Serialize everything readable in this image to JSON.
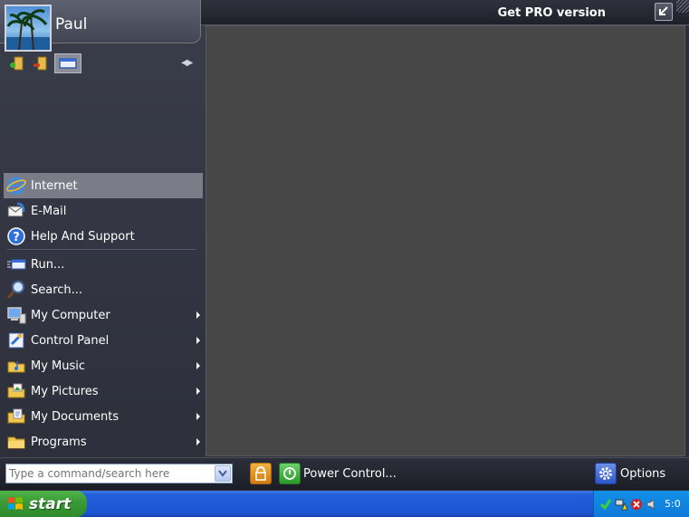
{
  "user": {
    "name": "Paul"
  },
  "header": {
    "get_pro": "Get PRO version"
  },
  "menu": {
    "pinned": [
      {
        "label": "Internet",
        "icon": "internet-explorer-icon",
        "submenu": false,
        "highlight": true
      },
      {
        "label": "E-Mail",
        "icon": "email-icon",
        "submenu": false
      },
      {
        "label": "Help And Support",
        "icon": "help-icon",
        "submenu": false
      }
    ],
    "items": [
      {
        "label": "Run...",
        "icon": "run-icon",
        "submenu": false
      },
      {
        "label": "Search...",
        "icon": "search-icon",
        "submenu": false
      },
      {
        "label": "My Computer",
        "icon": "computer-icon",
        "submenu": true
      },
      {
        "label": "Control Panel",
        "icon": "control-panel-icon",
        "submenu": true
      },
      {
        "label": "My Music",
        "icon": "music-folder-icon",
        "submenu": true
      },
      {
        "label": "My Pictures",
        "icon": "pictures-folder-icon",
        "submenu": true
      },
      {
        "label": "My Documents",
        "icon": "documents-folder-icon",
        "submenu": true
      },
      {
        "label": "Programs",
        "icon": "programs-folder-icon",
        "submenu": true
      }
    ]
  },
  "bottom": {
    "search_placeholder": "Type a command/search here",
    "power_label": "Power Control...",
    "options_label": "Options"
  },
  "taskbar": {
    "start_label": "start",
    "clock": "5:0"
  }
}
